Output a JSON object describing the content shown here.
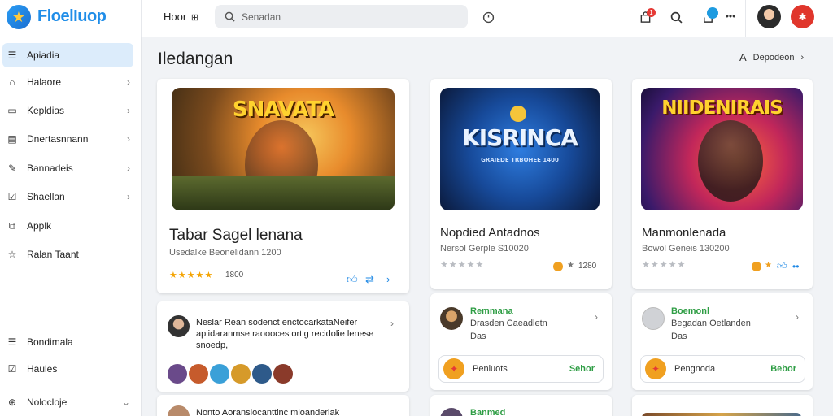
{
  "app": {
    "brand": "FloelIuop"
  },
  "topbar": {
    "home_label": "Hoor",
    "home_icon": "grid-icon",
    "search_placeholder": "Senadan",
    "badge_count": "1"
  },
  "sidebar": {
    "items": [
      {
        "label": "Apiadia",
        "icon": "list-icon",
        "active": true
      },
      {
        "label": "Halaore",
        "icon": "home-icon",
        "chevron": true
      },
      {
        "label": "Kepldias",
        "icon": "window-icon",
        "chevron": true
      },
      {
        "label": "Dnertasnnann",
        "icon": "doc-icon",
        "chevron": true
      },
      {
        "label": "Bannadeis",
        "icon": "edit-icon",
        "chevron": true
      },
      {
        "label": "Shaellan",
        "icon": "check-icon",
        "chevron": true
      },
      {
        "label": "Applk",
        "icon": "puzzle-icon"
      },
      {
        "label": "Ralan Taant",
        "icon": "star-icon"
      },
      {
        "label": "Bondimala",
        "icon": "list-icon"
      },
      {
        "label": "Haules",
        "icon": "check-icon"
      },
      {
        "label": "Nolocloje",
        "icon": "globe-icon",
        "chevron": true
      }
    ]
  },
  "main": {
    "heading": "Iledangan",
    "sort_label": "Depodeon",
    "sort_icon": "A",
    "featured": {
      "art_title": "SNAVATA",
      "title": "Tabar Sagel lenana",
      "subtitle": "Usedalke Beonelidann 1200",
      "stars": "★★★★★",
      "count": "1800"
    },
    "comment1": {
      "text": "Neslar Rean sodenct enctocarkataNeifer apiidaranmse raoooces ortig recidolie lenese snoedp,",
      "extra": "0"
    },
    "comment2": {
      "text": "Nonto Aoranslocanttinc mloanderlak"
    },
    "game2": {
      "art_title": "KISRINCA",
      "art_sub": "GRAIEDE TRBOHEE 1400",
      "title": "Nopdied Antadnos",
      "subtitle": "Nersol Gerple S10020",
      "stars": "★★★★★",
      "count": "1280",
      "card_name": "Remmana",
      "card_line1": "Drasden Caeadletn",
      "card_line2": "Das",
      "pill_label": "Penluots",
      "pill_action": "Sehor",
      "bottom_name": "Banmed"
    },
    "game3": {
      "art_title": "NIIDENIRAIS",
      "title": "Manmonlenada",
      "subtitle": "Bowol Geneis 130200",
      "stars": "★★★★★",
      "card_name": "Boemonl",
      "card_line1": "Begadan Oetlanden",
      "card_line2": "Das",
      "pill_label": "Pengnoda",
      "pill_action": "Bebor"
    }
  }
}
